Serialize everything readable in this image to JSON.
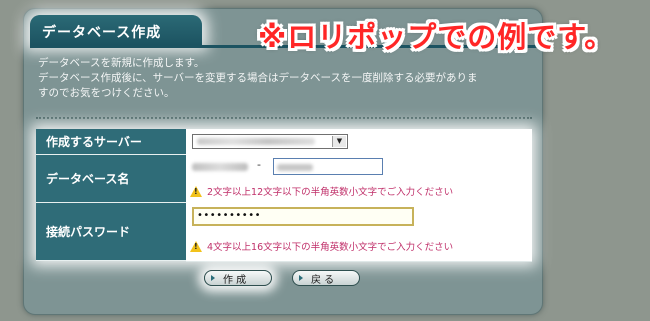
{
  "panel": {
    "title": "データベース作成",
    "description": [
      "データベースを新規に作成します。",
      "データベース作成後に、サーバーを変更する場合はデータベースを一度削除する必要がありま",
      "すのでお気をつけください。"
    ]
  },
  "form": {
    "server": {
      "label": "作成するサーバー"
    },
    "db_name": {
      "label": "データベース名",
      "separator": "-",
      "warning": "2文字以上12文字以下の半角英数小文字でご入力ください"
    },
    "password": {
      "label": "接続パスワード",
      "value": "••••••••••",
      "warning": "4文字以上16文字以下の半角英数小文字でご入力ください"
    }
  },
  "buttons": {
    "create": "作 成",
    "back": "戻 る"
  },
  "annotation": "※ロリポップでの例です。",
  "colors": {
    "panel_bg": "#7e9494",
    "header_bg": "#1c5361",
    "label_bg": "#2f6c78",
    "warning_text": "#c0306a",
    "annotation_text": "#ff2626"
  }
}
